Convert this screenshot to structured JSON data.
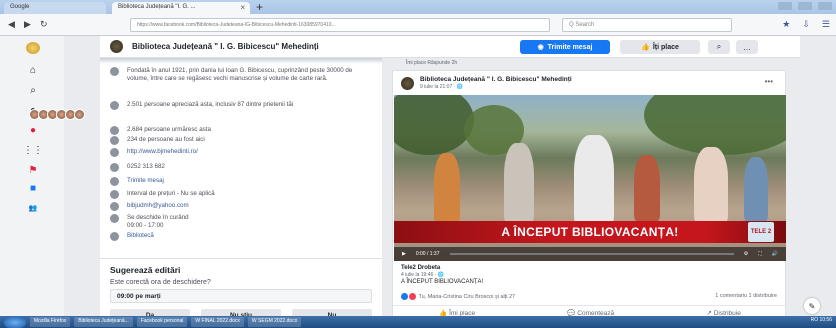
{
  "browser": {
    "tabs": [
      {
        "label": "Google"
      },
      {
        "label": "Biblioteca Județeană \"I. G. ...",
        "close": "×"
      }
    ],
    "new_tab": "+",
    "url": "https://www.facebook.com/Biblioteca-Judeteana-IG-Bibicescu-Mehedinti-163085970410...",
    "search_placeholder": "Q Search"
  },
  "page": {
    "name": "Biblioteca Județeană \" I. G. Bibicescu\" Mehedinți",
    "send_message": "Trimite mesaj",
    "like": "Îți place",
    "search_icon": "search-icon",
    "more": "…"
  },
  "about": {
    "rows": [
      {
        "icon": "info-icon",
        "text": "Fondată în anul 1921, prin dania lui Ioan G. Bibicescu, cuprinzând peste 30000 de volume, între care se regăsesc vechi manuscrise și volume de carte rară."
      },
      {
        "icon": "like-icon",
        "text": "2.501 persoane apreciază asta, inclusiv 87 dintre prietenii tăi"
      },
      {
        "icon": "follow-icon",
        "text": "2.684 persoane urmăresc asta"
      },
      {
        "icon": "checkin-icon",
        "text": "234 de persoane au fost aici"
      },
      {
        "icon": "globe-icon",
        "text": "http://www.bjmehedinti.ro/",
        "link": true
      },
      {
        "icon": "phone-icon",
        "text": "0252 313 682"
      },
      {
        "icon": "messenger-icon",
        "text": "Trimite mesaj",
        "link": true
      },
      {
        "icon": "price-icon",
        "text": "Interval de prețuri - Nu se aplică"
      },
      {
        "icon": "mail-icon",
        "text": "bibjudmh@yahoo.com",
        "link": true
      },
      {
        "icon": "clock-icon",
        "text": "Se deschide în curând",
        "subtext": "09:00 - 17:00"
      },
      {
        "icon": "category-icon",
        "text": "Bibliotecă",
        "link": true
      }
    ]
  },
  "suggest": {
    "title": "Sugerează editări",
    "question": "Este corectă ora de deschidere?",
    "value": "09:00 pe marți",
    "buttons": [
      "Da",
      "Nu știu",
      "Nu"
    ]
  },
  "post": {
    "tabs_line": "Îmi place   Răspunde   2h",
    "author": "Biblioteca Județeană \" I. G. Bibicescu\" Mehedinți",
    "date": "9 iulie la 21:07 · 🌐",
    "banner": "A ÎNCEPUT BIBLIOVACANȚA!",
    "logo": "TELE 2",
    "time": "0:00 / 1:37",
    "shared_name": "Tele2 Drobeta",
    "shared_date": "4 iulie la 19:46 · 🌐",
    "shared_text": "A ÎNCEPUT BIBLIOVACANȚA!",
    "reactions": "Tu, Maria-Cristina Ciru Broscoi și alți 27",
    "counts": "1 comentariu  1 distribuire",
    "actions": [
      "Îmi place",
      "Comentează",
      "Distribuie"
    ]
  },
  "taskbar": {
    "items": [
      "Mozilla Firefox",
      "Biblioteca Județeană...",
      "Facebook personal",
      "W FINAL 2022.docx",
      "W SEGM 2022.docx"
    ],
    "clock": "RO 10:56"
  }
}
